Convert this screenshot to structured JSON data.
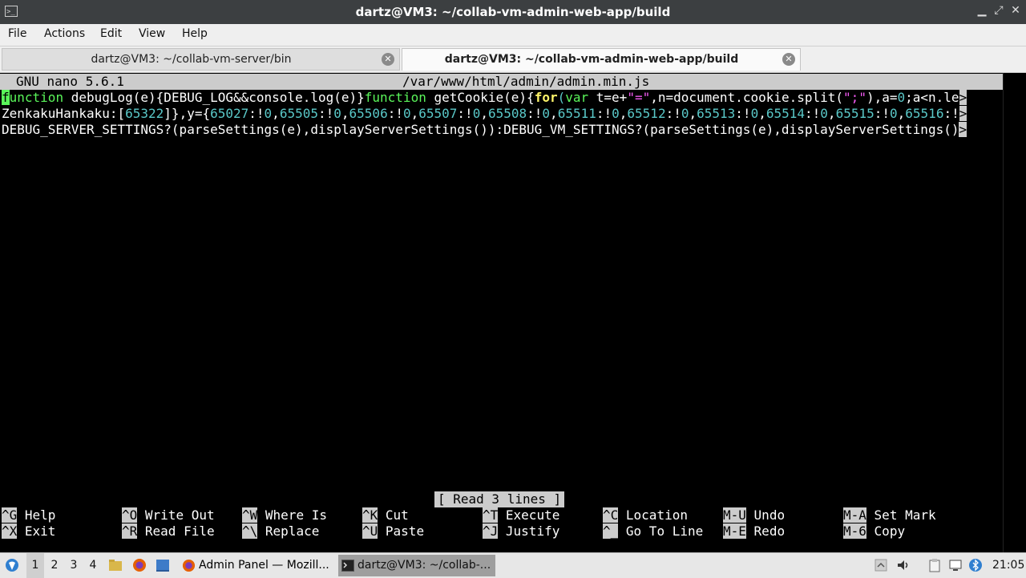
{
  "window": {
    "title": "dartz@VM3: ~/collab-vm-admin-web-app/build",
    "controls": [
      "minimize",
      "maximize",
      "close"
    ],
    "accent": "#3c3f41"
  },
  "menu": [
    "File",
    "Actions",
    "Edit",
    "View",
    "Help"
  ],
  "tabs": [
    {
      "label": "dartz@VM3: ~/collab-vm-server/bin",
      "active": false
    },
    {
      "label": "dartz@VM3: ~/collab-vm-admin-web-app/build",
      "active": true
    }
  ],
  "nano": {
    "version": "GNU nano 5.6.1",
    "file": "/var/www/html/admin/admin.min.js",
    "line1": {
      "cursor_word": "f",
      "kw_function_rest": "unction",
      "a": " debugLog(e){DEBUG_LOG&&console.log(e)}",
      "kw_function2": "function",
      "b": " getCookie(e){",
      "kw_for": "for",
      "c": "(",
      "kw_var": "var",
      "d": " t=e+",
      "str1": "\"=\"",
      "e": ",n=document.cookie.split(",
      "str2": "\";\"",
      "f": "),a=",
      "n0": "0",
      "g": ";a<n.le",
      "trunc": ">"
    },
    "line2": {
      "a": "ZenkakuHankaku:[",
      "n1": "65322",
      "b": "]},y={",
      "n2": "65027",
      "b2": ":!",
      "n3": "0",
      "c": ",",
      "n4": "65505",
      "c2": ":!",
      "n5": "0",
      "d": ",",
      "n6": "65506",
      "d2": ":!",
      "n7": "0",
      "e": ",",
      "n8": "65507",
      "e2": ":!",
      "n9": "0",
      "f": ",",
      "n10": "65508",
      "f2": ":!",
      "n11": "0",
      "g": ",",
      "n12": "65511",
      "g2": ":!",
      "n13": "0",
      "h": ",",
      "n14": "65512",
      "h2": ":!",
      "n15": "0",
      "i": ",",
      "n16": "65513",
      "i2": ":!",
      "n17": "0",
      "j": ",",
      "n18": "65514",
      "j2": ":!",
      "n19": "0",
      "k": ",",
      "n20": "65515",
      "k2": ":!",
      "n21": "0",
      "l": ",",
      "n22": "65516",
      "l2": ":!",
      "trunc": ">"
    },
    "line3": {
      "text": "DEBUG_SERVER_SETTINGS?(parseSettings(e),displayServerSettings()):DEBUG_VM_SETTINGS?(parseSettings(e),displayServerSettings()",
      "trunc": ">"
    },
    "status": "[ Read 3 lines ]",
    "shortcuts": [
      {
        "key": "^G",
        "label": "Help"
      },
      {
        "key": "^O",
        "label": "Write Out"
      },
      {
        "key": "^W",
        "label": "Where Is"
      },
      {
        "key": "^K",
        "label": "Cut"
      },
      {
        "key": "^T",
        "label": "Execute"
      },
      {
        "key": "^C",
        "label": "Location"
      },
      {
        "key": "M-U",
        "label": "Undo"
      },
      {
        "key": "M-A",
        "label": "Set Mark"
      },
      {
        "key": "^X",
        "label": "Exit"
      },
      {
        "key": "^R",
        "label": "Read File"
      },
      {
        "key": "^\\",
        "label": "Replace"
      },
      {
        "key": "^U",
        "label": "Paste"
      },
      {
        "key": "^J",
        "label": "Justify"
      },
      {
        "key": "^_",
        "label": "Go To Line"
      },
      {
        "key": "M-E",
        "label": "Redo"
      },
      {
        "key": "M-6",
        "label": "Copy"
      }
    ]
  },
  "taskbar": {
    "workspaces": [
      "1",
      "2",
      "3",
      "4"
    ],
    "active_workspace": "1",
    "tasks": [
      {
        "label": "Admin Panel — Mozill...",
        "icon": "firefox-icon"
      },
      {
        "label": "dartz@VM3: ~/collab-...",
        "icon": "terminal-icon"
      }
    ],
    "clock": "21:05"
  }
}
